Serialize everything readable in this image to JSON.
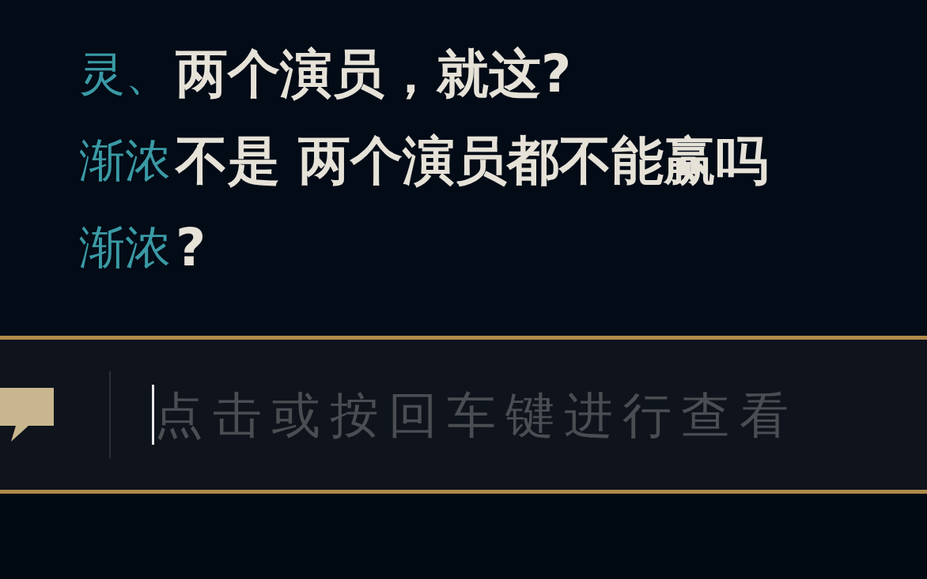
{
  "messages": [
    {
      "name": "灵、",
      "text": "两个演员，就这?"
    },
    {
      "name": "渐浓",
      "text": "不是 两个演员都不能赢吗"
    },
    {
      "name": "渐浓",
      "text": "?"
    }
  ],
  "input": {
    "placeholder": "点击或按回车键进行查看"
  }
}
